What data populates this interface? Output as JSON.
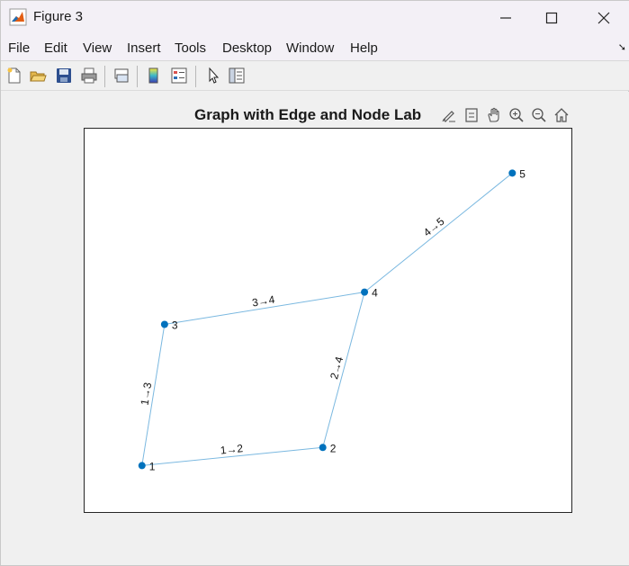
{
  "window": {
    "title": "Figure 3",
    "minimize_icon": "minimize-icon",
    "maximize_icon": "maximize-icon",
    "close_icon": "close-icon"
  },
  "menu": {
    "items": [
      "File",
      "Edit",
      "View",
      "Insert",
      "Tools",
      "Desktop",
      "Window",
      "Help"
    ],
    "corner_icon": "dock-arrow-icon"
  },
  "toolbar": {
    "buttons": [
      "new-figure-icon",
      "open-file-icon",
      "save-icon",
      "print-icon",
      "link-plot-icon",
      "colorbar-icon",
      "legend-icon",
      "pointer-icon",
      "property-inspector-icon"
    ]
  },
  "axes_toolbar": {
    "buttons": [
      "brush-icon",
      "data-tips-icon",
      "pan-icon",
      "zoom-in-icon",
      "zoom-out-icon",
      "home-icon"
    ]
  },
  "plot": {
    "title": "Graph with Edge and Node Lab"
  },
  "chart_data": {
    "type": "graph",
    "title": "Graph with Edge and Node Lab",
    "xlim": [
      0.6,
      3.4
    ],
    "ylim": [
      0.0,
      1.9
    ],
    "nodes": [
      {
        "id": "1",
        "x": 0.93,
        "y": 0.23
      },
      {
        "id": "2",
        "x": 1.97,
        "y": 0.32
      },
      {
        "id": "3",
        "x": 1.06,
        "y": 0.93
      },
      {
        "id": "4",
        "x": 2.21,
        "y": 1.09
      },
      {
        "id": "5",
        "x": 3.06,
        "y": 1.68
      }
    ],
    "edges": [
      {
        "source": "1",
        "target": "2",
        "label": "1→2"
      },
      {
        "source": "1",
        "target": "3",
        "label": "1→3"
      },
      {
        "source": "2",
        "target": "4",
        "label": "2→4"
      },
      {
        "source": "3",
        "target": "4",
        "label": "3→4"
      },
      {
        "source": "4",
        "target": "5",
        "label": "4→5"
      }
    ],
    "node_color": "#0072bd",
    "edge_color": "#7ab8e0",
    "grid": false
  }
}
